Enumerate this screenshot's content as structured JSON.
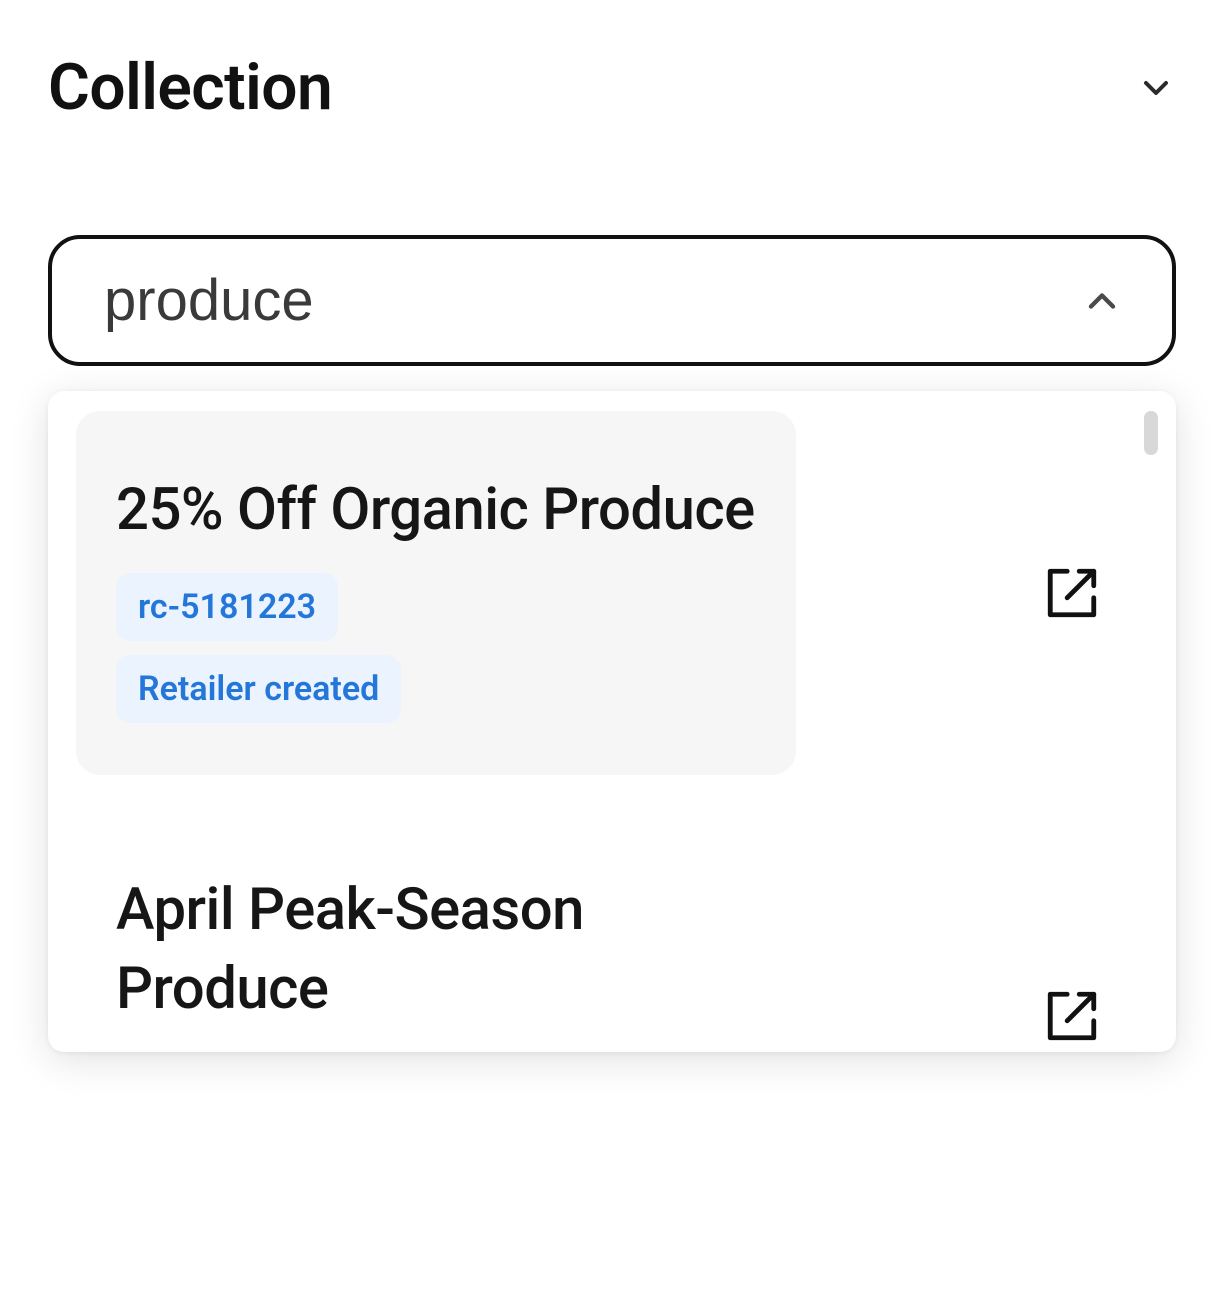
{
  "section": {
    "title": "Collection"
  },
  "combobox": {
    "value": "produce"
  },
  "options": [
    {
      "title": "25% Off Organic Produce",
      "code": "rc-5181223",
      "tag": "Retailer created"
    },
    {
      "title": "April Peak-Season Produce"
    }
  ]
}
